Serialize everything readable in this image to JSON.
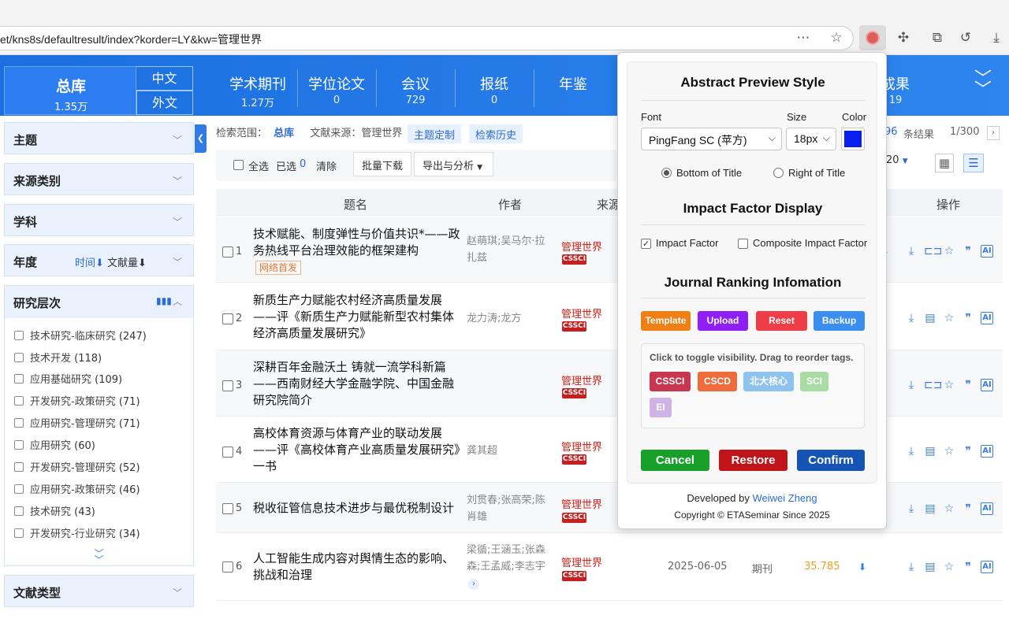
{
  "browser": {
    "url": "et/kns8s/defaultresult/index?korder=LY&kw=管理世界",
    "icons": [
      "more-icon",
      "star-icon",
      "extension-eta-icon",
      "puzzle-icon",
      "collections-icon",
      "history-icon",
      "download-icon"
    ]
  },
  "nav": {
    "zongku": {
      "label": "总库",
      "count": "1.35万"
    },
    "zhongwen": "中文",
    "waiwen": "外文",
    "items": [
      {
        "label": "学术期刊",
        "count": "1.27万"
      },
      {
        "label": "学位论文",
        "count": "0"
      },
      {
        "label": "会议",
        "count": "729"
      },
      {
        "label": "报纸",
        "count": "0"
      },
      {
        "label": "年鉴",
        "count": ""
      },
      {
        "label": "成果",
        "count": "19"
      }
    ]
  },
  "sidebar": {
    "sections": {
      "topic": "主题",
      "source_type": "来源类别",
      "discipline": "学科",
      "year": "年度",
      "year_sort_time": "时间⬇",
      "year_sort_count": "文献量⬇",
      "level": "研究层次",
      "doc_type": "文献类型"
    },
    "facets": [
      {
        "label": "技术研究-临床研究",
        "count": "(247)"
      },
      {
        "label": "技术开发",
        "count": "(118)"
      },
      {
        "label": "应用基础研究",
        "count": "(109)"
      },
      {
        "label": "开发研究-政策研究",
        "count": "(71)"
      },
      {
        "label": "应用研究-管理研究",
        "count": "(71)"
      },
      {
        "label": "应用研究",
        "count": "(60)"
      },
      {
        "label": "开发研究-管理研究",
        "count": "(52)"
      },
      {
        "label": "应用研究-政策研究",
        "count": "(46)"
      },
      {
        "label": "技术研究",
        "count": "(43)"
      },
      {
        "label": "开发研究-行业研究",
        "count": "(34)"
      }
    ]
  },
  "search": {
    "scope_label": "检索范围：",
    "scope_value": "总库",
    "source_label": "文献来源：管理世界",
    "custom_topic": "主题定制",
    "history": "检索历史",
    "result_prefix": "96",
    "result_suffix": "条结果",
    "page": "1/300",
    "select_all": "全选",
    "selected_label": "已选",
    "selected_count": "0",
    "clear": "清除",
    "batch_download": "批量下载",
    "export": "导出与分析",
    "page_size": "20"
  },
  "table": {
    "headers": {
      "title": "题名",
      "author": "作者",
      "source": "来源",
      "ops": "操作"
    },
    "rows": [
      {
        "num": "1",
        "title": "技术赋能、制度弹性与价值共识*——政务热线平台治理效能的框架建构",
        "badge": "网络首发",
        "authors": "赵萌琪;吴马尔·拉扎兹",
        "source": "管理世界",
        "tag": "CSSCI"
      },
      {
        "num": "2",
        "title": "新质生产力赋能农村经济高质量发展——评《新质生产力赋能新型农村集体经济高质量发展研究》",
        "badge": "",
        "authors": "龙力涛;龙方",
        "source": "管理世界",
        "tag": "CSSCI"
      },
      {
        "num": "3",
        "title": "深耕百年金融沃土 铸就一流学科新篇——西南财经大学金融学院、中国金融研究院简介",
        "badge": "",
        "authors": "",
        "source": "管理世界",
        "tag": "CSSCI"
      },
      {
        "num": "4",
        "title": "高校体育资源与体育产业的联动发展——评《高校体育产业高质量发展研究》一书",
        "badge": "",
        "authors": "龚其超",
        "source": "管理世界",
        "tag": "CSSCI"
      },
      {
        "num": "5",
        "title": "税收征管信息技术进步与最优税制设计",
        "badge": "",
        "authors": "刘贯春;张高荣;陈肖雄",
        "source": "管理世界",
        "tag": "CSSCI"
      },
      {
        "num": "6",
        "title": "人工智能生成内容对舆情生态的影响、挑战和治理",
        "badge": "",
        "authors": "梁循;王涵玉;张森森;王孟威;李志宇",
        "source": "管理世界",
        "tag": "CSSCI",
        "date": "2025-06-05",
        "type": "期刊",
        "downloads": "35.785"
      }
    ]
  },
  "popup": {
    "abstract_title": "Abstract Preview Style",
    "font_label": "Font",
    "size_label": "Size",
    "color_label": "Color",
    "font_value": "PingFang SC (苹方)",
    "size_value": "18px",
    "color_value": "#0a1ef0",
    "pos_bottom": "Bottom of Title",
    "pos_right": "Right of Title",
    "impact_title": "Impact Factor Display",
    "impact_factor": "Impact Factor",
    "composite_factor": "Composite Impact Factor",
    "ranking_title": "Journal Ranking Infomation",
    "btn_template": "Template",
    "btn_upload": "Upload",
    "btn_reset": "Reset",
    "btn_backup": "Backup",
    "tag_hint": "Click to toggle visibility. Drag to reorder tags.",
    "tags": [
      "CSSCI",
      "CSCD",
      "北大核心",
      "SCI",
      "EI"
    ],
    "cancel": "Cancel",
    "restore": "Restore",
    "confirm": "Confirm",
    "developed_by": "Developed by ",
    "developer": "Weiwei Zheng",
    "copyright": "Copyright © ETASeminar Since 2025",
    "colors": {
      "orange": "#f07f14",
      "purple": "#8f1ff5",
      "red": "#ee3d46",
      "blue": "#3a8ef0",
      "green": "#17a02a",
      "darkred": "#c0141a",
      "navy": "#1553b5"
    }
  }
}
